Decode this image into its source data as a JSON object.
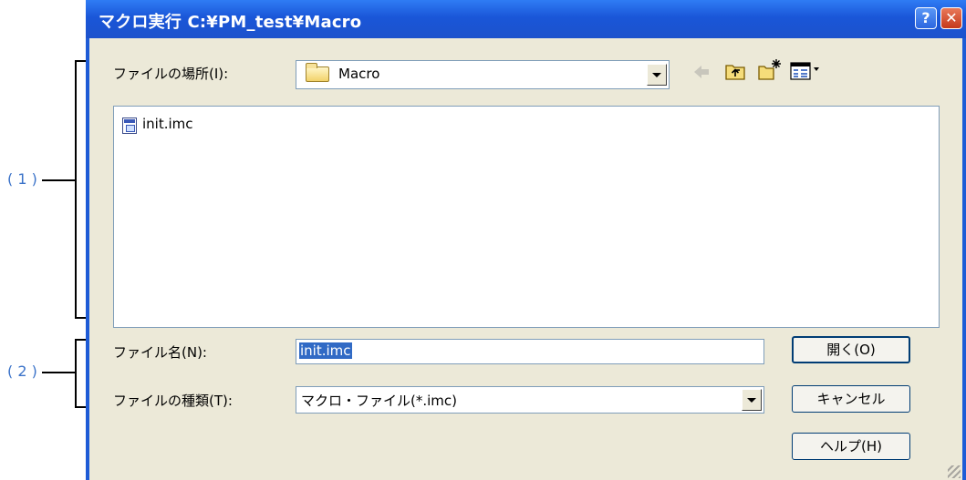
{
  "annotations": {
    "callout_1": "( 1 )",
    "callout_2": "( 2 )"
  },
  "dialog": {
    "title": "マクロ実行 C:¥PM_test¥Macro",
    "title_buttons": [
      "help-icon",
      "close-icon"
    ],
    "look_in": {
      "label": "ファイルの場所(I):",
      "value": "Macro",
      "icon": "folder-icon"
    },
    "toolbar": [
      "back-arrow-icon",
      "up-folder-icon",
      "new-folder-icon",
      "view-menu-icon"
    ],
    "files": [
      {
        "name": "init.imc",
        "icon": "macro-file-icon"
      }
    ],
    "file_name": {
      "label": "ファイル名(N):",
      "value": "init.imc"
    },
    "file_type": {
      "label": "ファイルの種類(T):",
      "value": "マクロ・ファイル(*.imc)"
    },
    "buttons": {
      "open": "開く(O)",
      "cancel": "キャンセル",
      "help": "ヘルプ(H)"
    }
  }
}
